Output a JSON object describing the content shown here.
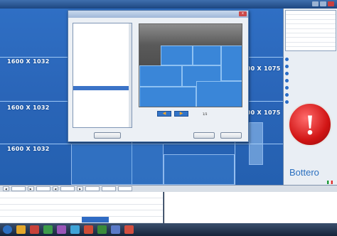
{
  "menubar": {
    "items": [
      "",
      "",
      "",
      "",
      "",
      ""
    ],
    "window_controls": [
      "minimize",
      "maximize",
      "close"
    ]
  },
  "canvas": {
    "dimension_labels": [
      "1600 X 1032",
      "1600 X 1032",
      "1600 X 1032",
      "1600 X 1075",
      "1600 X 1075"
    ]
  },
  "dialog": {
    "title": "",
    "close_label": "x",
    "list_items": [
      "",
      "",
      "",
      "",
      "",
      "",
      "",
      "",
      "",
      "",
      "",
      "",
      "",
      "",
      "",
      "",
      "",
      "",
      "",
      "",
      "",
      "",
      "",
      "",
      ""
    ],
    "selected_index": 15,
    "nav_label": "",
    "nav_prev_icon": "arrow-left-icon",
    "nav_next_icon": "arrow-right-icon",
    "page_indicator": "1/3",
    "info_lines": [
      "",
      ""
    ],
    "buttons": {
      "left": "",
      "ok": "",
      "cancel": ""
    }
  },
  "right_panel": {
    "coord_rows": [
      [
        "",
        "",
        ""
      ],
      [
        "",
        "",
        ""
      ],
      [
        "",
        "",
        ""
      ],
      [
        "",
        "",
        ""
      ],
      [
        "",
        "",
        ""
      ],
      [
        "",
        "",
        ""
      ],
      [
        "",
        "",
        ""
      ],
      [
        "",
        "",
        ""
      ]
    ],
    "status_items": [
      "",
      "",
      "",
      "",
      "",
      "",
      ""
    ],
    "alarm_symbol": "!",
    "brand": "Bottero",
    "brand_sub": "",
    "colors": {
      "alarm": "#d11515",
      "accent": "#2a6fbf"
    }
  },
  "bottom_toolbar": {
    "fields": [
      "",
      "",
      "",
      "",
      "",
      ""
    ]
  },
  "data_table": {
    "rows": [
      [
        "",
        "",
        "",
        "",
        "",
        ""
      ],
      [
        "",
        "",
        "",
        "",
        "",
        ""
      ],
      [
        "",
        "",
        "",
        "",
        "",
        ""
      ],
      [
        "",
        "",
        "",
        "",
        "",
        ""
      ],
      [
        "",
        "",
        "",
        "",
        "",
        ""
      ]
    ],
    "highlight": [
      4,
      3
    ]
  },
  "taskbar": {
    "time": ""
  }
}
